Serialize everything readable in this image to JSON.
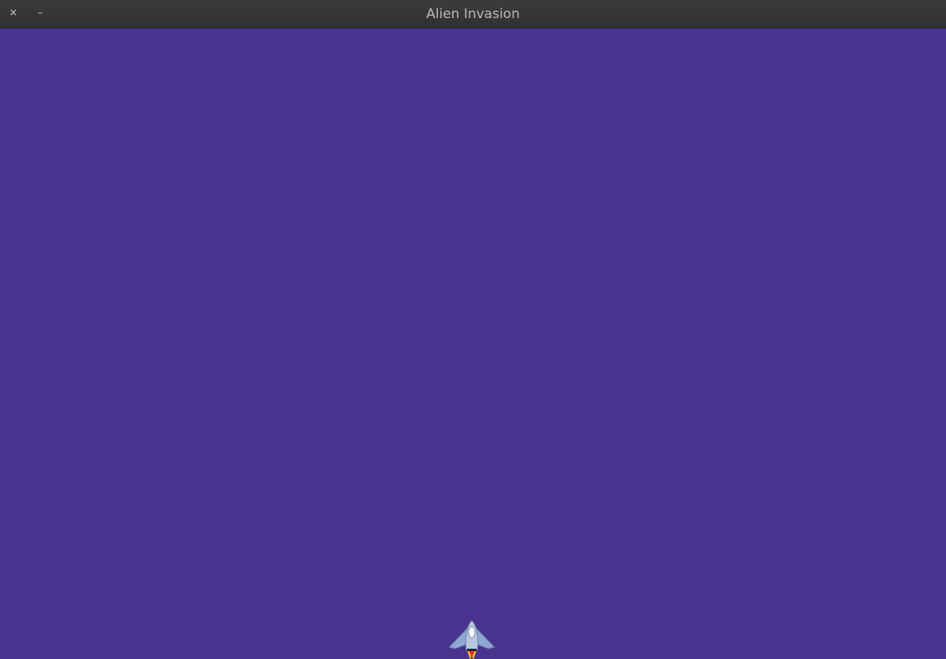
{
  "window": {
    "title": "Alien Invasion",
    "close_glyph": "×",
    "minimize_glyph": "–"
  },
  "game": {
    "background_color": "#48338e",
    "ship_icon": "rocket-ship-icon"
  }
}
